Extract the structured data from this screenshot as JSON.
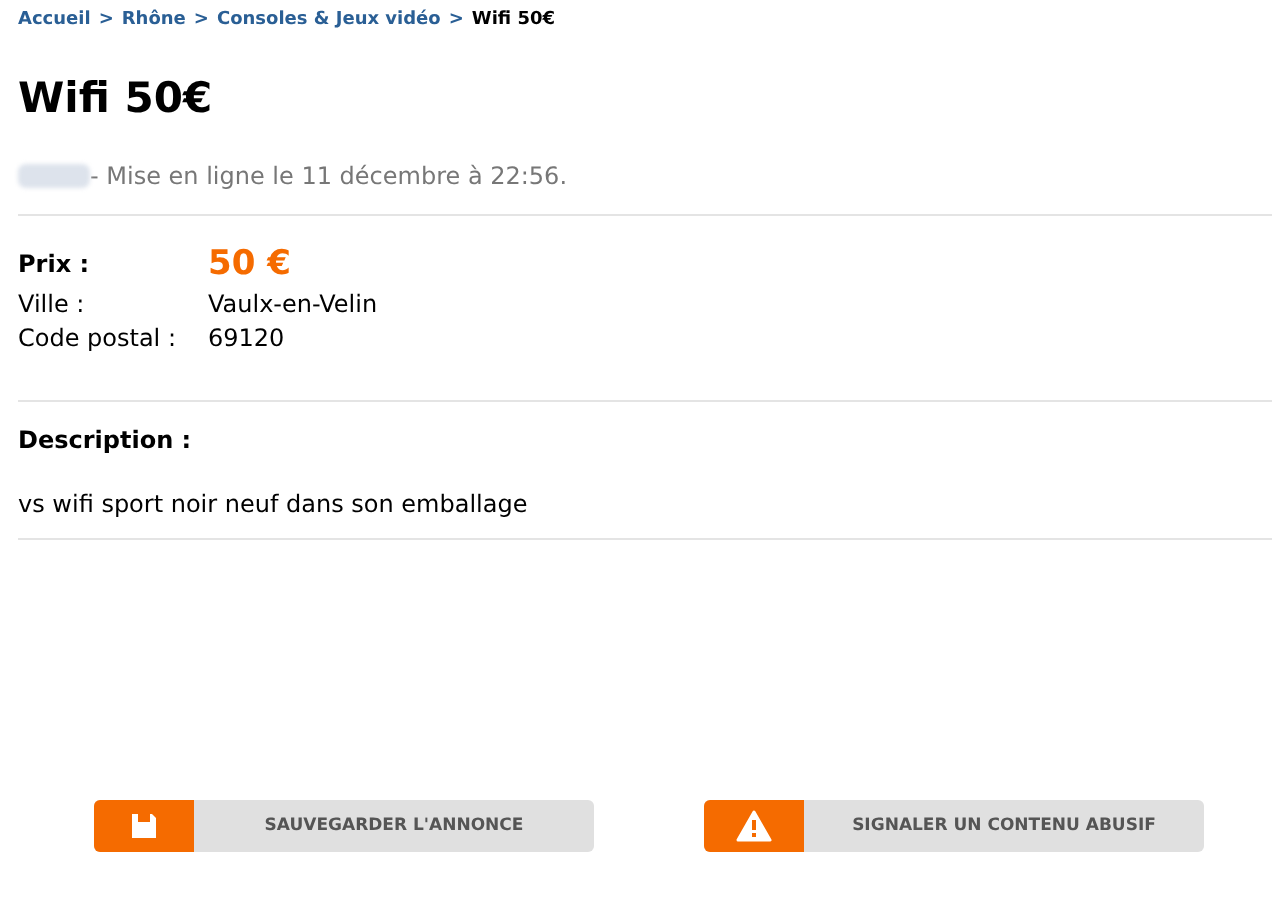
{
  "breadcrumb": [
    {
      "kind": "link",
      "text": "Accueil"
    },
    {
      "kind": "separator",
      "text": ">"
    },
    {
      "kind": "link",
      "text": "Rhône"
    },
    {
      "kind": "separator",
      "text": ">"
    },
    {
      "kind": "link",
      "text": "Consoles & Jeux vidéo"
    },
    {
      "kind": "separator",
      "text": ">"
    },
    {
      "kind": "current",
      "text": "Wifi 50€"
    }
  ],
  "title": "Wifi 50€",
  "posted": "- Mise en ligne le 11 décembre à 22:56.",
  "details": [
    {
      "kind": "price",
      "label": "Prix :",
      "value": "50 €"
    },
    {
      "kind": "plain",
      "label": "Ville :",
      "value": "Vaulx-en-Velin"
    },
    {
      "kind": "plain",
      "label": "Code postal :",
      "value": "69120"
    }
  ],
  "description": {
    "heading": "Description :",
    "text": "vs wifi sport noir neuf dans son emballage"
  },
  "actions": [
    {
      "kind": "save",
      "label": "SAUVEGARDER L'ANNONCE"
    },
    {
      "kind": "report",
      "label": "SIGNALER UN CONTENU ABUSIF"
    }
  ]
}
